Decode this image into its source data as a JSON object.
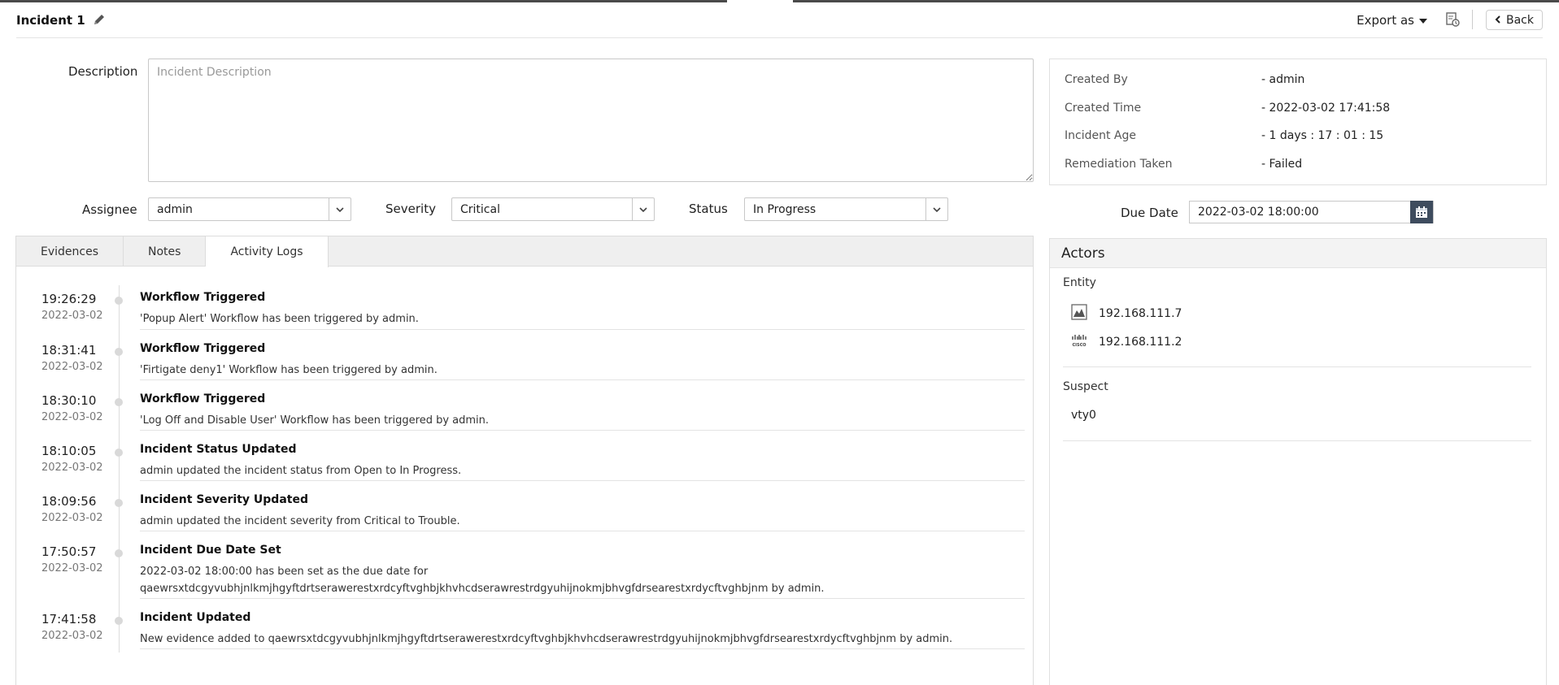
{
  "header": {
    "title": "Incident 1",
    "export_label": "Export as",
    "back_label": "Back"
  },
  "description": {
    "label": "Description",
    "placeholder": "Incident Description",
    "value": ""
  },
  "fields": {
    "assignee_label": "Assignee",
    "assignee_value": "admin",
    "severity_label": "Severity",
    "severity_value": "Critical",
    "status_label": "Status",
    "status_value": "In Progress"
  },
  "info": {
    "created_by_label": "Created By",
    "created_by_value": "- admin",
    "created_time_label": "Created Time",
    "created_time_value": "- 2022-03-02 17:41:58",
    "age_label": "Incident Age",
    "age_value": "- 1 days : 17 : 01 : 15",
    "remediation_label": "Remediation Taken",
    "remediation_value": "- Failed"
  },
  "due": {
    "label": "Due Date",
    "value": "2022-03-02 18:00:00"
  },
  "tabs": [
    {
      "label": "Evidences",
      "active": false
    },
    {
      "label": "Notes",
      "active": false
    },
    {
      "label": "Activity Logs",
      "active": true
    }
  ],
  "logs": [
    {
      "time": "19:26:29",
      "date": "2022-03-02",
      "title": "Workflow Triggered",
      "desc": "'Popup Alert' Workflow has been triggered by admin."
    },
    {
      "time": "18:31:41",
      "date": "2022-03-02",
      "title": "Workflow Triggered",
      "desc": "'Firtigate deny1' Workflow has been triggered by admin."
    },
    {
      "time": "18:30:10",
      "date": "2022-03-02",
      "title": "Workflow Triggered",
      "desc": "'Log Off and Disable User' Workflow has been triggered by admin."
    },
    {
      "time": "18:10:05",
      "date": "2022-03-02",
      "title": "Incident Status Updated",
      "desc": "admin updated the incident status from Open to In Progress."
    },
    {
      "time": "18:09:56",
      "date": "2022-03-02",
      "title": "Incident Severity Updated",
      "desc": "admin updated the incident severity from Critical to Trouble."
    },
    {
      "time": "17:50:57",
      "date": "2022-03-02",
      "title": "Incident Due Date Set",
      "desc": "2022-03-02 18:00:00 has been set as the due date for qaewrsxtdcgyvubhjnlkmjhgyftdrtserawerestxrdcyftvghbjkhvhcdserawrestrdgyuhijnokmjbhvgfdrsearestxrdycftvghbjnm by admin."
    },
    {
      "time": "17:41:58",
      "date": "2022-03-02",
      "title": "Incident Updated",
      "desc": "New evidence added to qaewrsxtdcgyvubhjnlkmjhgyftdrtserawerestxrdcyftvghbjkhvhcdserawrestrdgyuhijnokmjbhvgfdrsearestxrdycftvghbjnm by admin."
    }
  ],
  "actors": {
    "title": "Actors",
    "entity_label": "Entity",
    "entities": [
      {
        "name": "192.168.111.7",
        "icon": "device-icon"
      },
      {
        "name": "192.168.111.2",
        "icon": "cisco-icon"
      }
    ],
    "suspect_label": "Suspect",
    "suspects": [
      "vty0"
    ]
  }
}
